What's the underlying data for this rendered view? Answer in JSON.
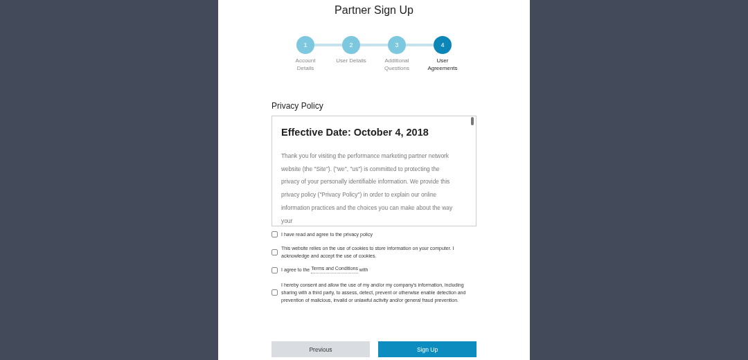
{
  "title": "Partner Sign Up",
  "steps": [
    {
      "number": "1",
      "label": "Account Details",
      "selected": false
    },
    {
      "number": "2",
      "label": "User Details",
      "selected": false
    },
    {
      "number": "3",
      "label": "Additional Questions",
      "selected": false
    },
    {
      "number": "4",
      "label": "User Agreements",
      "selected": true
    }
  ],
  "policy": {
    "heading": "Privacy Policy",
    "effective_date": "Effective Date: October 4, 2018",
    "body": "Thank you for visiting the performance marketing partner network website (the \"Site\"). (\"we\", \"us\") is committed to protecting the privacy of your personally identifiable information. We provide this privacy policy (\"Privacy Policy\") in order to explain our online information practices and the choices you can make about the way your"
  },
  "agreements": [
    {
      "text": "I have read and agree to the privacy policy",
      "checked": false
    },
    {
      "text": "This website relies on the use of cookies to store information on your computer. I acknowledge and accept the use of cookies.",
      "checked": false
    },
    {
      "text": "I agree to the",
      "link": "Terms and Conditions",
      "text_after": "with",
      "checked": false
    },
    {
      "text": "I hereby consent and allow the use of my and/or my company's information, including sharing with a third party, to assess, detect, prevent or otherwise enable detection and prevention of malicious, invalid or unlawful activity and/or general fraud prevention.",
      "checked": false
    }
  ],
  "buttons": {
    "previous": "Previous",
    "submit": "Sign Up"
  }
}
